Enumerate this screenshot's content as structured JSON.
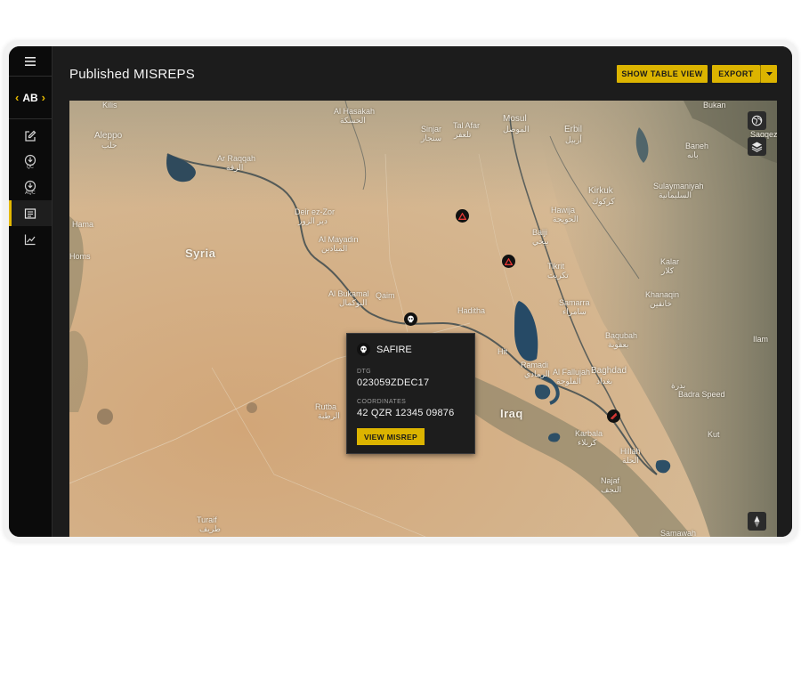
{
  "app": {
    "unit_code": "AB",
    "page_title": "Published MISREPS"
  },
  "sidebar": {
    "items": [
      {
        "icon": "edit-icon",
        "sub": ""
      },
      {
        "icon": "download-qc-icon",
        "sub": "QC"
      },
      {
        "icon": "download-aqc-icon",
        "sub": "AQC"
      },
      {
        "icon": "report-list-icon",
        "sub": "",
        "active": true
      },
      {
        "icon": "chart-line-icon",
        "sub": ""
      }
    ]
  },
  "header": {
    "show_table_label": "SHOW TABLE VIEW",
    "export_label": "EXPORT"
  },
  "map": {
    "labels": {
      "kilis": "Kilis",
      "al_hasakah": "Al Hasakah",
      "al_hasakah_ar": "الحسكة",
      "mosul": "Mosul",
      "mosul_ar": "الموصل",
      "erbil": "Erbil",
      "erbil_ar": "أربيل",
      "bukan": "Bukan",
      "sinjar": "Sinjar",
      "sinjar_ar": "سنجار",
      "tal_afar": "Tal Afar",
      "tal_afar_ar": "تلعفر",
      "aleppo": "Aleppo",
      "aleppo_ar": "حلب",
      "ar_raqqah": "Ar Raqqah",
      "ar_raqqah_ar": "الرقة",
      "baneh": "Baneh",
      "baneh_ar": "بانه",
      "saqqez": "Saqqez",
      "sulaymaniyah": "Sulaymaniyah",
      "sulaymaniyah_ar": "السليمانية",
      "kirkuk": "Kirkuk",
      "kirkuk_ar": "كركوك",
      "hawija": "Hawija",
      "hawija_ar": "الحويجة",
      "deir_ez_zor": "Deir ez-Zor",
      "deir_ez_zor_ar": "دير الزور",
      "al_mayadin": "Al Mayadin",
      "al_mayadin_ar": "الميادين",
      "hama": "Hama",
      "syria": "Syria",
      "homs": "Homs",
      "baiji": "Baiji",
      "baiji_ar": "بيجي",
      "tikrit": "Tikrit",
      "tikrit_ar": "تكريت",
      "kalar": "Kalar",
      "kalar_ar": "كلار",
      "al_bukamal": "Al Bukamal",
      "al_bukamal_ar": "البوكمال",
      "qaim": "Qaim",
      "haditha": "Haditha",
      "samarra": "Samarra",
      "samarra_ar": "سامراء",
      "khanaqin": "Khanaqin",
      "khanaqin_ar": "خانقين",
      "baqubah": "Baqubah",
      "baqubah_ar": "بعقوبة",
      "hit": "Hit",
      "ramadi": "Ramadi",
      "ramadi_ar": "الرمادي",
      "al_fallujah": "Al Fallujah",
      "al_fallujah_ar": "الفلوجة",
      "baghdad": "Baghdad",
      "baghdad_ar": "بغداد",
      "iraq": "Iraq",
      "rutba": "Rutba",
      "rutba_ar": "الرطبة",
      "karbala": "Karbala",
      "karbala_ar": "كربلاء",
      "hillah": "Hillah",
      "hillah_ar": "الحلة",
      "najaf": "Najaf",
      "najaf_ar": "النجف",
      "turaif": "Turaif",
      "turaif_ar": "طريف",
      "samawah": "Samawah",
      "ilam": "Ilam",
      "kut": "Kut",
      "badra_ar": "بدرة",
      "badra_speed": "Badra Speed"
    }
  },
  "popup": {
    "event_type": "SAFIRE",
    "dtg_label": "DTG",
    "dtg_value": "023059ZDEC17",
    "coordinates_label": "COORDINATES",
    "coordinates_value": "42 QZR 12345 09876",
    "view_label": "VIEW MISREP"
  },
  "colors": {
    "accent": "#dcb400",
    "sidebar_bg": "#0b0b0b",
    "header_bg": "#1c1c1c",
    "marker_threat": "#e53935"
  }
}
